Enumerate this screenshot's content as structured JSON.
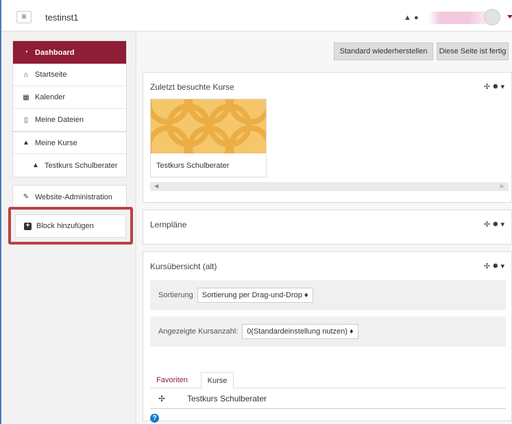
{
  "header": {
    "menu_icon": "hamburger-icon",
    "site_name": "testinst1",
    "bell_icon": "bell-icon",
    "chat_icon": "chat-icon",
    "user_avatar_icon": "avatar-icon"
  },
  "sidebar": {
    "items": [
      {
        "label": "Dashboard",
        "icon": "dashboard-icon"
      },
      {
        "label": "Startseite",
        "icon": "home-icon"
      },
      {
        "label": "Kalender",
        "icon": "calendar-icon"
      },
      {
        "label": "Meine Dateien",
        "icon": "file-icon"
      },
      {
        "label": "Meine Kurse",
        "icon": "graduation-cap-icon"
      },
      {
        "label": "Testkurs Schulberater",
        "icon": "graduation-cap-icon"
      }
    ],
    "admin": {
      "label": "Website-Administration",
      "icon": "wrench-icon"
    },
    "add_block": {
      "label": "Block hinzufügen",
      "icon": "plus-square-icon"
    }
  },
  "toolbar": {
    "reset_label": "Standard wiederherstellen",
    "done_label": "Diese Seite ist fertig"
  },
  "recent_courses": {
    "title": "Zuletzt besuchte Kurse",
    "course_name": "Testkurs Schulberater"
  },
  "learning_plans": {
    "title": "Lernpläne"
  },
  "course_overview": {
    "title": "Kursübersicht (alt)",
    "sort_label": "Sortierung",
    "sort_value": "Sortierung per Drag-und-Drop ♦",
    "count_label": "Angezeigte Kursanzahl:",
    "count_value": "0(Standardeinstellung nutzen) ♦",
    "tabs": [
      {
        "label": "Favoriten"
      },
      {
        "label": "Kurse"
      }
    ],
    "course_name": "Testkurs Schulberater"
  },
  "colors": {
    "accent": "#8f1d35",
    "highlight": "#bf4040",
    "course_image": "#f6c66a",
    "help": "#1a7ac8"
  }
}
